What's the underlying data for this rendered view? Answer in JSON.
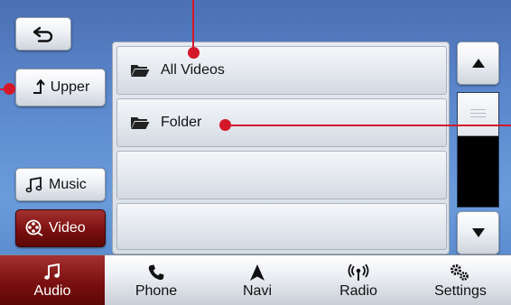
{
  "sidebar": {
    "upper_label": "Upper",
    "music_label": "Music",
    "video_label": "Video"
  },
  "list": {
    "items": [
      {
        "label": "All Videos",
        "icon": "folder-icon"
      },
      {
        "label": "Folder",
        "icon": "folder-icon"
      },
      {
        "label": ""
      },
      {
        "label": ""
      }
    ]
  },
  "tabs": [
    {
      "label": "Audio",
      "icon": "music-note-icon",
      "active": true
    },
    {
      "label": "Phone",
      "icon": "phone-icon",
      "active": false
    },
    {
      "label": "Navi",
      "icon": "navi-arrow-icon",
      "active": false
    },
    {
      "label": "Radio",
      "icon": "radio-signal-icon",
      "active": false
    },
    {
      "label": "Settings",
      "icon": "gears-icon",
      "active": false
    }
  ],
  "colors": {
    "active": "#7b1010",
    "callout": "#d4182a",
    "background": "#5a86cc"
  }
}
